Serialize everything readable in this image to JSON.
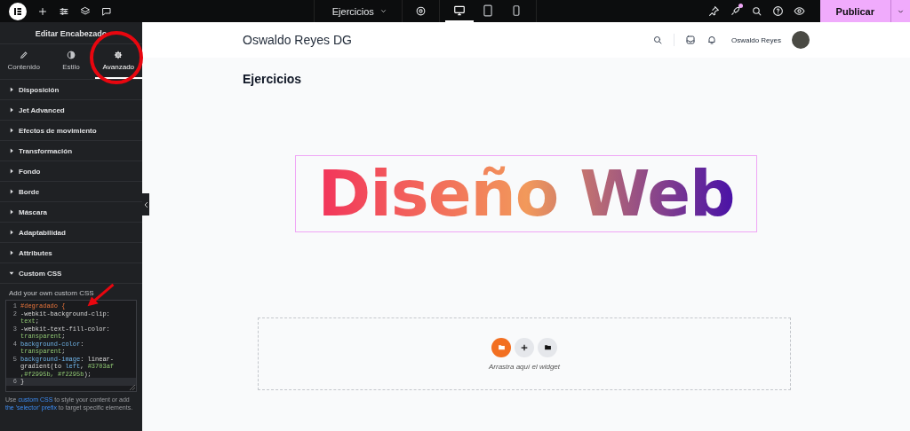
{
  "topbar": {
    "page_selector": "Ejercicios",
    "devices": [
      {
        "selected": true
      },
      {
        "selected": false
      },
      {
        "selected": false
      }
    ],
    "publish_button": "Publicar",
    "notification_dot": true
  },
  "panel": {
    "title": "Editar Encabezado",
    "tabs": [
      {
        "label": "Contenido",
        "selected": false
      },
      {
        "label": "Estilo",
        "selected": false
      },
      {
        "label": "Avanzado",
        "selected": true
      }
    ],
    "sections": [
      {
        "label": "Disposición",
        "expanded": false
      },
      {
        "label": "Jet Advanced",
        "expanded": false
      },
      {
        "label": "Efectos de movimiento",
        "expanded": false
      },
      {
        "label": "Transformación",
        "expanded": false
      },
      {
        "label": "Fondo",
        "expanded": false
      },
      {
        "label": "Borde",
        "expanded": false
      },
      {
        "label": "Máscara",
        "expanded": false
      },
      {
        "label": "Adaptabilidad",
        "expanded": false
      },
      {
        "label": "Attributes",
        "expanded": false
      },
      {
        "label": "Custom CSS",
        "expanded": true
      }
    ],
    "css_label": "Add your own custom CSS",
    "code": [
      {
        "number": "1",
        "parts": [
          {
            "kind": "selector",
            "text": "#degradado {"
          }
        ]
      },
      {
        "number": "2",
        "parts": [
          {
            "kind": "property",
            "text": "-webkit-background-clip: "
          },
          {
            "kind": "value",
            "text": "text"
          },
          {
            "kind": "plain",
            "text": ";"
          }
        ]
      },
      {
        "number": "3",
        "parts": [
          {
            "kind": "property",
            "text": "-webkit-text-fill-color: "
          },
          {
            "kind": "value",
            "text": "transparent"
          },
          {
            "kind": "plain",
            "text": ";"
          }
        ]
      },
      {
        "number": "4",
        "parts": [
          {
            "kind": "keyword",
            "text": "background-color"
          },
          {
            "kind": "plain",
            "text": ": "
          },
          {
            "kind": "value",
            "text": "transparent"
          },
          {
            "kind": "plain",
            "text": ";"
          }
        ]
      },
      {
        "number": "5",
        "parts": [
          {
            "kind": "keyword",
            "text": "background-image"
          },
          {
            "kind": "plain",
            "text": ": linear-gradient(to "
          },
          {
            "kind": "keyword",
            "text": "left"
          },
          {
            "kind": "plain",
            "text": ", "
          },
          {
            "kind": "value",
            "text": "#3703af ,#f2995b, #f2295b"
          },
          {
            "kind": "plain",
            "text": ");"
          }
        ]
      },
      {
        "number": "6",
        "parts": [
          {
            "kind": "plain",
            "text": "}"
          }
        ]
      }
    ],
    "help": [
      {
        "kind": "text",
        "text": "Use "
      },
      {
        "kind": "link",
        "text": "custom CSS"
      },
      {
        "kind": "text",
        "text": " to style your content or add "
      },
      {
        "kind": "link",
        "text": "the 'selector' prefix"
      },
      {
        "kind": "text",
        "text": " to target specific elements."
      }
    ]
  },
  "canvas": {
    "site_title": "Oswaldo Reyes DG",
    "user_name": "Oswaldo Reyes",
    "page_heading": "Ejercicios",
    "gradient_heading": "Diseño Web",
    "dropzone_hint": "Arrastra aquí el widget"
  }
}
